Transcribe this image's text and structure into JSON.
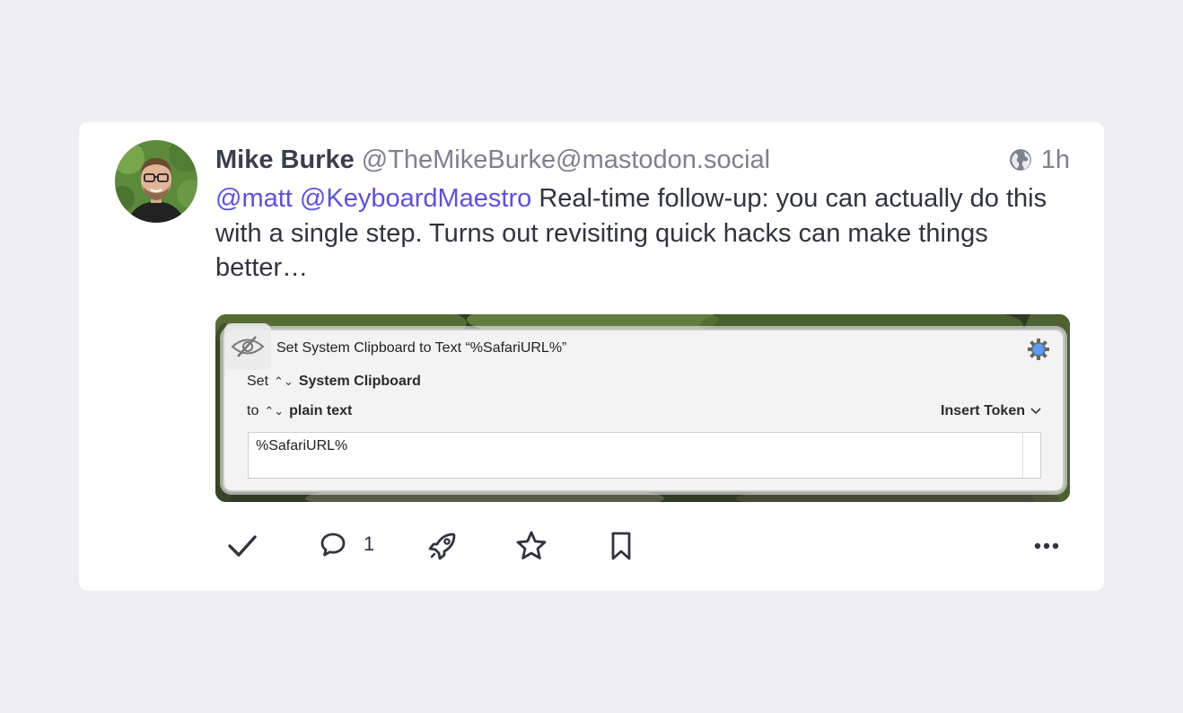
{
  "post": {
    "author": {
      "display_name": "Mike Burke",
      "handle": "@TheMikeBurke@mastodon.social",
      "avatar": "avatar-photo"
    },
    "visibility_icon": "globe-icon",
    "time": "1h",
    "content": {
      "mentions": [
        "@matt",
        "@KeyboardMaestro"
      ],
      "text": "Real-time follow-up: you can actually do this with a single step. Turns out revisiting quick hacks can make things better…"
    },
    "media": {
      "action_title": "Set System Clipboard to Text “%SafariURL%”",
      "set_label": "Set",
      "set_target": "System Clipboard",
      "to_label": "to",
      "to_format": "plain text",
      "insert_token_label": "Insert Token",
      "text_value": "%SafariURL%"
    },
    "actions": {
      "reply_count": "1"
    }
  },
  "colors": {
    "page_bg": "#efeff3",
    "card_bg": "#ffffff",
    "mention": "#5b50e8",
    "muted": "#7c8190",
    "text": "#2f3440"
  }
}
